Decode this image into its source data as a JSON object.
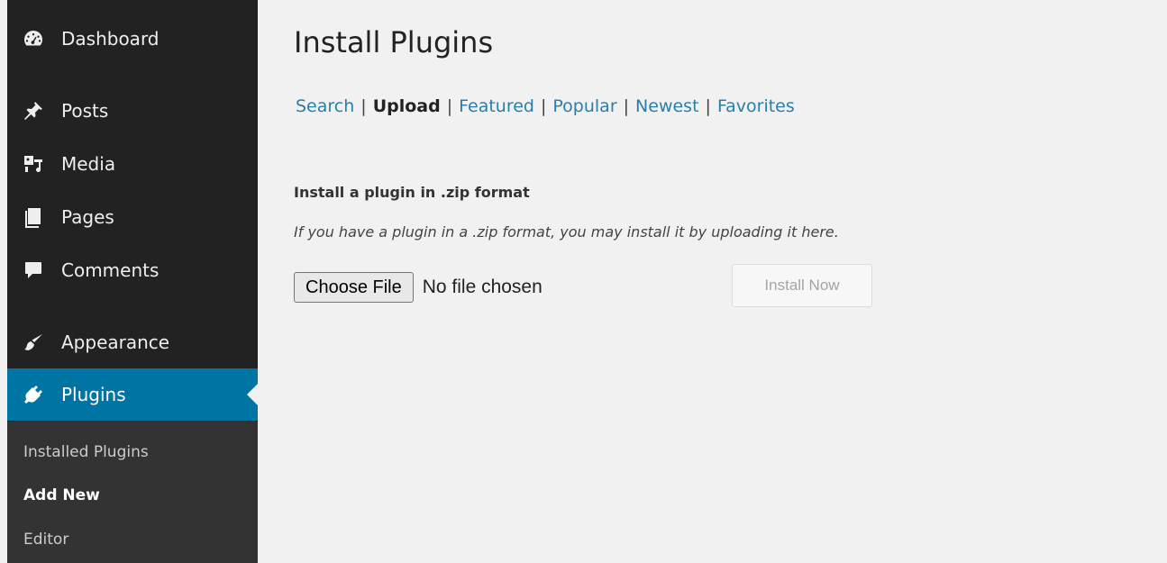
{
  "sidebar": {
    "menu": [
      {
        "label": "Dashboard",
        "icon": "dashboard-icon"
      },
      {
        "label": "Posts",
        "icon": "pin-icon"
      },
      {
        "label": "Media",
        "icon": "media-icon"
      },
      {
        "label": "Pages",
        "icon": "pages-icon"
      },
      {
        "label": "Comments",
        "icon": "comment-bubble-icon"
      },
      {
        "label": "Appearance",
        "icon": "paintbrush-icon"
      },
      {
        "label": "Plugins",
        "icon": "plug-icon",
        "active": true
      }
    ],
    "submenu": [
      {
        "label": "Installed Plugins"
      },
      {
        "label": "Add New",
        "current": true
      },
      {
        "label": "Editor"
      }
    ]
  },
  "main": {
    "title": "Install Plugins",
    "tabs": [
      {
        "label": "Search"
      },
      {
        "label": "Upload",
        "current": true
      },
      {
        "label": "Featured"
      },
      {
        "label": "Popular"
      },
      {
        "label": "Newest"
      },
      {
        "label": "Favorites"
      }
    ],
    "tab_separator": "|",
    "heading": "Install a plugin in .zip format",
    "description": "If you have a plugin in a .zip format, you may install it by uploading it here.",
    "choose_file_label": "Choose File",
    "no_file_text": "No file chosen",
    "install_button_label": "Install Now"
  },
  "colors": {
    "sidebar_bg": "#222222",
    "submenu_bg": "#333333",
    "active_bg": "#0074a2",
    "link": "#2a7ea8",
    "page_bg": "#f1f1f1"
  }
}
